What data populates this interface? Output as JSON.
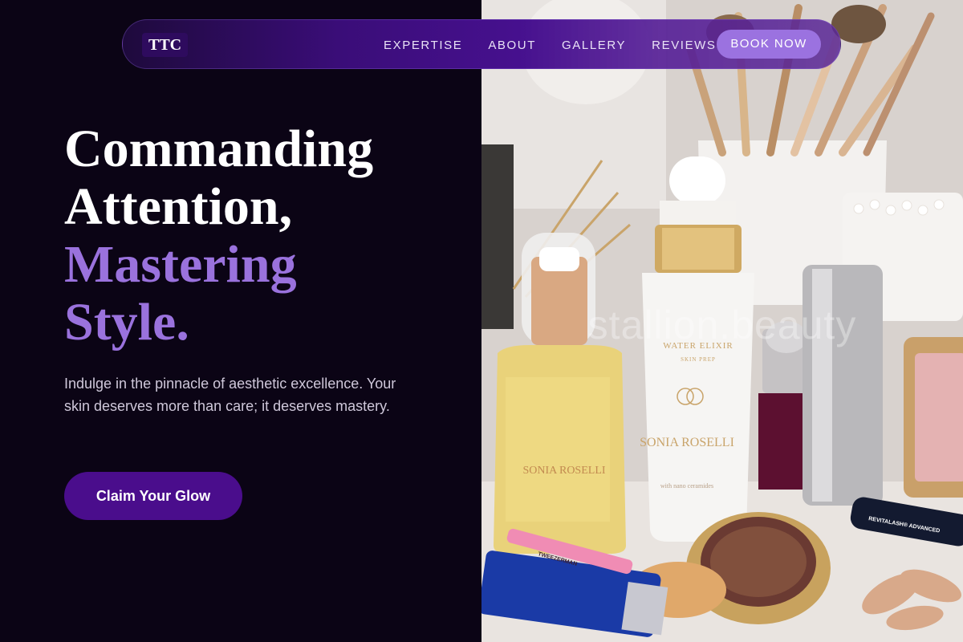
{
  "brand": {
    "logo_text": "TTC"
  },
  "nav": {
    "links": [
      "EXPERTISE",
      "ABOUT",
      "GALLERY",
      "REVIEWS"
    ],
    "cta_label": "BOOK NOW"
  },
  "hero": {
    "headline_line1": "Commanding",
    "headline_line2": "Attention,",
    "headline_accent_line1": "Mastering",
    "headline_accent_line2": "Style.",
    "subtext": "Indulge in the pinnacle of aesthetic excellence. Your skin deserves more than care; it deserves mastery.",
    "cta_label": "Claim Your Glow"
  },
  "photo": {
    "watermark": "stallion.beauty",
    "product_labels": {
      "serum_brand": "SONIA ROSELLI",
      "serum_name": "WATER ELIXIR",
      "serum_sub": "SKIN PREP",
      "serum_note": "with nano ceramides",
      "oil_brand": "SONIA ROSELLI",
      "tweezer": "TWEEZERMAN",
      "lash": "REVITALASH® ADVANCED"
    }
  },
  "colors": {
    "background": "#0b0415",
    "accent": "#9a72dd",
    "nav_bg": "#3a0d78",
    "book_button": "#9b72e0",
    "cta_button": "#4a0d8c"
  }
}
